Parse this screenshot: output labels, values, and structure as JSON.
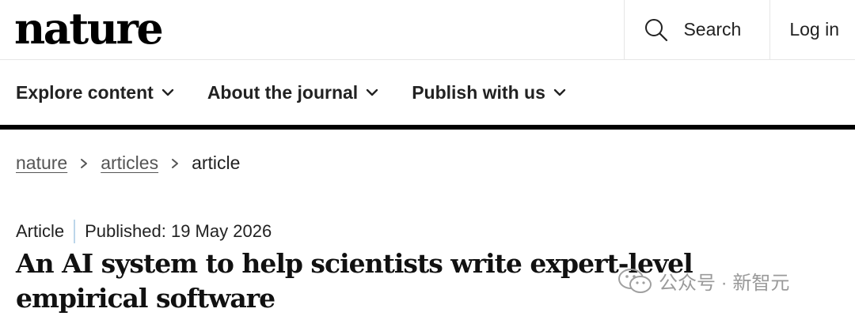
{
  "header": {
    "logo": "nature",
    "search_label": "Search",
    "login_label": "Log in"
  },
  "nav": {
    "items": [
      {
        "label": "Explore content"
      },
      {
        "label": "About the journal"
      },
      {
        "label": "Publish with us"
      }
    ]
  },
  "breadcrumb": {
    "items": [
      "nature",
      "articles"
    ],
    "current": "article"
  },
  "article": {
    "type": "Article",
    "published": "Published: 19 May 2026",
    "title": "An AI system to help scientists write expert-level empirical software"
  },
  "watermark": {
    "text": "公众号 · 新智元"
  },
  "icons": {
    "search": "search-icon",
    "chevron": "chevron-down-icon",
    "breadcrumb_sep": "chevron-right-icon",
    "watermark": "wechat-icon"
  }
}
